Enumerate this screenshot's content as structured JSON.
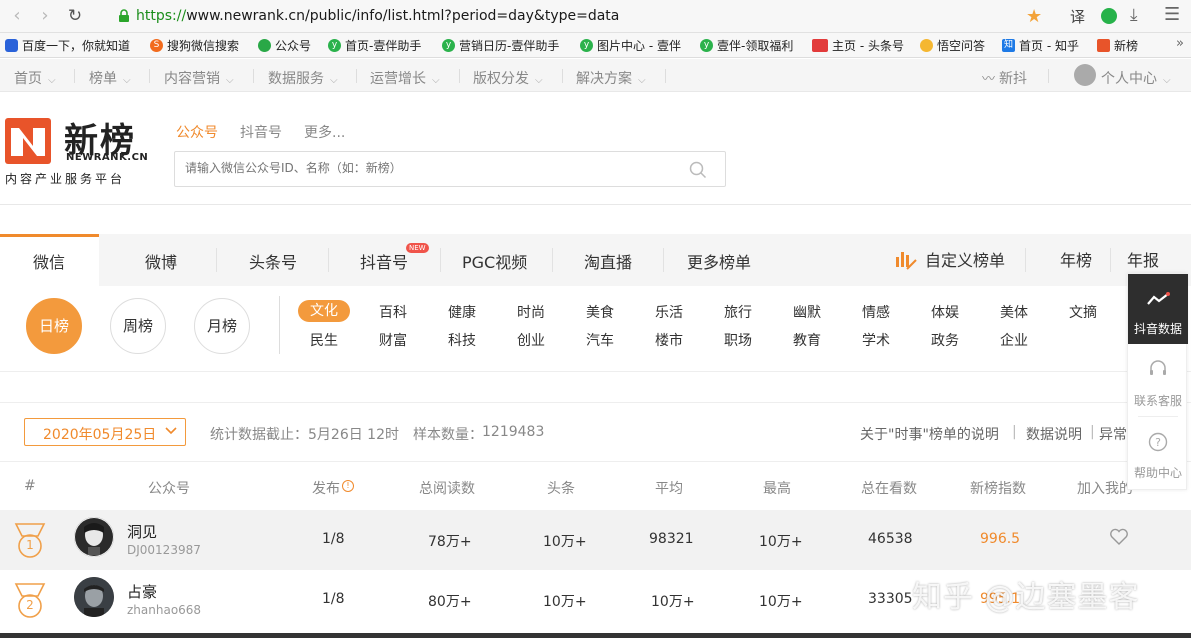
{
  "browser": {
    "url_scheme": "https://",
    "url_rest": "www.newrank.cn/public/info/list.html?period=day&type=data",
    "translate_label": "译",
    "bookmarks": [
      "百度一下，你就知道",
      "搜狗微信搜索",
      "公众号",
      "首页-壹伴助手",
      "营销日历-壹伴助手",
      "图片中心 - 壹伴",
      "壹伴-领取福利",
      "主页 - 头条号",
      "悟空问答",
      "首页 - 知乎",
      "新榜"
    ]
  },
  "topnav": {
    "items": [
      "首页",
      "榜单",
      "内容营销",
      "数据服务",
      "运营增长",
      "版权分发",
      "解决方案"
    ],
    "right": [
      "新抖",
      "个人中心"
    ]
  },
  "header": {
    "logo_text": "新榜",
    "logo_en": "NEWRANK.CN",
    "logo_cn": "内容产业服务平台",
    "search_tabs": [
      "公众号",
      "抖音号",
      "更多..."
    ],
    "search_placeholder": "请输入微信公众号ID、名称（如：新榜）"
  },
  "platform_tabs": {
    "items": [
      "微信",
      "微博",
      "头条号",
      "抖音号",
      "PGC视频",
      "淘直播",
      "更多榜单"
    ],
    "new_badge": "NEW",
    "custom": "自定义榜单",
    "year_rank": "年榜",
    "year_report": "年报"
  },
  "periods": [
    "日榜",
    "周榜",
    "月榜"
  ],
  "categories": {
    "row1": [
      "文化",
      "百科",
      "健康",
      "时尚",
      "美食",
      "乐活",
      "旅行",
      "幽默",
      "情感",
      "体娱",
      "美体",
      "文摘"
    ],
    "row2": [
      "民生",
      "财富",
      "科技",
      "创业",
      "汽车",
      "楼市",
      "职场",
      "教育",
      "学术",
      "政务",
      "企业"
    ]
  },
  "stats": {
    "date": "2020年05月25日",
    "cutoff_label": "统计数据截止：",
    "cutoff_value": "5月26日 12时",
    "sample_label": "样本数量：",
    "sample_value": "1219483",
    "links": [
      "关于\"时事\"榜单的说明",
      "数据说明",
      "异常"
    ]
  },
  "table": {
    "headers": [
      "#",
      "公众号",
      "发布",
      "总阅读数",
      "头条",
      "平均",
      "最高",
      "总在看数",
      "新榜指数",
      "加入我的"
    ],
    "rows": [
      {
        "rank": "1",
        "name": "洞见",
        "id": "DJ00123987",
        "publish": "1/8",
        "total_read": "78万+",
        "headline": "10万+",
        "avg": "98321",
        "max": "10万+",
        "total_look": "46538",
        "index": "996.5"
      },
      {
        "rank": "2",
        "name": "占豪",
        "id": "zhanhao668",
        "publish": "1/8",
        "total_read": "80万+",
        "headline": "10万+",
        "avg": "10万+",
        "max": "10万+",
        "total_look": "33305",
        "index": "995.1"
      }
    ]
  },
  "float_panel": {
    "douyin": "抖音数据",
    "service": "联系客服",
    "help": "帮助中心"
  },
  "watermark": "知乎 @边塞墨客",
  "colors": {
    "accent": "#f08a2c",
    "brand_red": "#e8542a"
  }
}
